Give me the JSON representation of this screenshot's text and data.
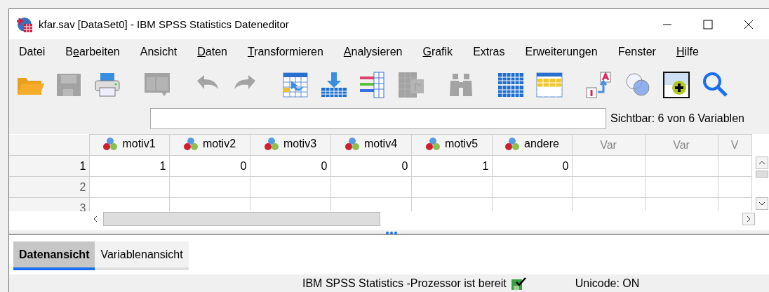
{
  "window": {
    "title": "kfar.sav [DataSet0] - IBM SPSS Statistics Dateneditor"
  },
  "menu": [
    {
      "label": "Datei"
    },
    {
      "before": "B",
      "key": "e",
      "after": "arbeiten"
    },
    {
      "label": "Ansicht"
    },
    {
      "key": "D",
      "after": "aten"
    },
    {
      "key": "T",
      "after": "ransformieren"
    },
    {
      "key": "A",
      "after": "nalysieren"
    },
    {
      "key": "G",
      "after": "rafik"
    },
    {
      "label": "Extras"
    },
    {
      "label": "Erweiterungen"
    },
    {
      "label": "Fenster"
    },
    {
      "key": "H",
      "after": "ilfe"
    }
  ],
  "toolbar": [
    {
      "kind": "open",
      "disabled": false
    },
    {
      "kind": "save",
      "disabled": true
    },
    {
      "kind": "print",
      "disabled": false
    },
    {
      "kind": "separator"
    },
    {
      "kind": "recall",
      "disabled": true
    },
    {
      "kind": "separator"
    },
    {
      "kind": "undo",
      "disabled": true
    },
    {
      "kind": "redo",
      "disabled": true
    },
    {
      "kind": "separator"
    },
    {
      "kind": "gotocase",
      "disabled": false
    },
    {
      "kind": "gotovar",
      "disabled": false
    },
    {
      "kind": "variables",
      "disabled": false
    },
    {
      "kind": "stats",
      "disabled": true
    },
    {
      "kind": "separator"
    },
    {
      "kind": "find",
      "disabled": true
    },
    {
      "kind": "separator"
    },
    {
      "kind": "split",
      "disabled": false
    },
    {
      "kind": "select",
      "disabled": false
    },
    {
      "kind": "separator"
    },
    {
      "kind": "labels",
      "disabled": false
    },
    {
      "kind": "sets",
      "disabled": false
    },
    {
      "kind": "spell",
      "disabled": false
    },
    {
      "kind": "search",
      "disabled": false
    }
  ],
  "visible_info": "Sichtbar: 6 von 6 Variablen",
  "table": {
    "columns": [
      {
        "label": "motiv1",
        "kind": "variable"
      },
      {
        "label": "motiv2",
        "kind": "variable"
      },
      {
        "label": "motiv3",
        "kind": "variable"
      },
      {
        "label": "motiv4",
        "kind": "variable"
      },
      {
        "label": "motiv5",
        "kind": "variable"
      },
      {
        "label": "andere",
        "kind": "variable"
      },
      {
        "label": "Var",
        "kind": "empty"
      },
      {
        "label": "Var",
        "kind": "empty"
      },
      {
        "label": "V",
        "kind": "empty"
      }
    ],
    "rows": [
      {
        "label": "1",
        "cells": [
          "1",
          "0",
          "0",
          "0",
          "1",
          "0",
          "",
          "",
          ""
        ]
      },
      {
        "label": "2",
        "cells": [
          "",
          "",
          "",
          "",
          "",
          "",
          "",
          "",
          ""
        ]
      },
      {
        "label": "3",
        "cells": [
          "",
          "",
          "",
          "",
          "",
          "",
          "",
          "",
          ""
        ]
      }
    ]
  },
  "view_tabs": [
    {
      "label": "Datenansicht",
      "selected": true
    },
    {
      "label": "Variablenansicht",
      "selected": false
    }
  ],
  "status_bar": {
    "message": "IBM SPSS Statistics -Prozessor ist bereit",
    "unicode": "Unicode: ON"
  }
}
